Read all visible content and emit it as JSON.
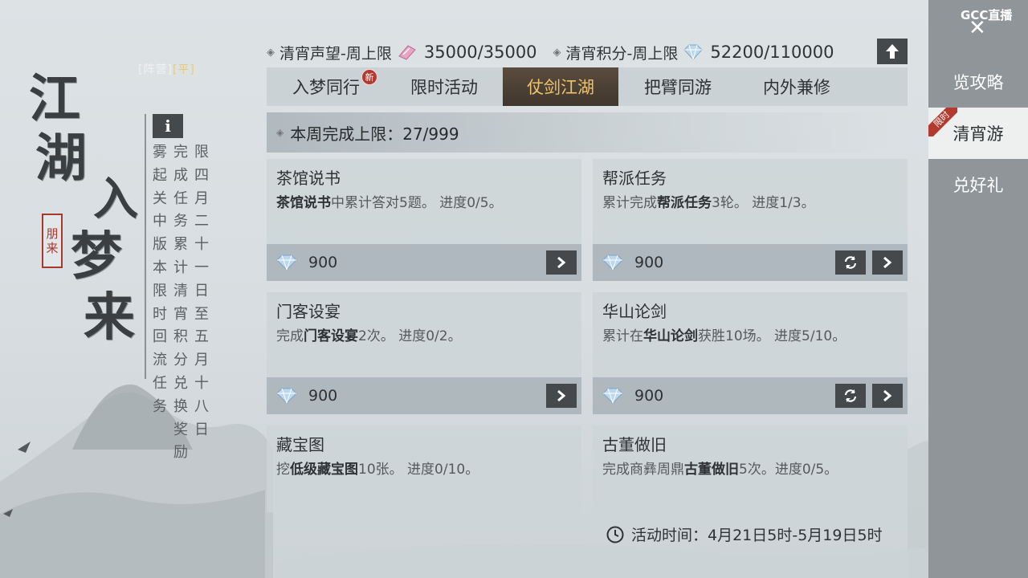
{
  "header": {
    "faint_tags": [
      "[阵营]",
      "[平]"
    ],
    "stat1": {
      "label": "清宵声望-周上限",
      "value": "35000/35000"
    },
    "stat2": {
      "label": "清宵积分-周上限",
      "value": "52200/110000"
    },
    "up_icon": "arrow-up-icon"
  },
  "title_art": {
    "chars": [
      "江",
      "湖",
      "入",
      "梦",
      "来"
    ],
    "seal": [
      "朋",
      "来"
    ]
  },
  "info": {
    "button": "i",
    "columns": [
      "雾起关中版本限时回流任务",
      "完成任务累计清宵积分兑换奖励",
      "限四月二十一日至五月十八日"
    ]
  },
  "tabs": [
    {
      "label": "入梦同行",
      "badge": "新"
    },
    {
      "label": "限时活动"
    },
    {
      "label": "仗剑江湖"
    },
    {
      "label": "把臂同游"
    },
    {
      "label": "内外兼修"
    }
  ],
  "banner": {
    "text": "本周完成上限：27/999"
  },
  "tasks": [
    {
      "name": "茶馆说书",
      "desc_pre": "",
      "desc_bold": "茶馆说书",
      "desc_post": "中累计答对5题。 进度0/5。",
      "reward": "900"
    },
    {
      "name": "帮派任务",
      "desc_pre": "累计完成",
      "desc_bold": "帮派任务",
      "desc_post": "3轮。 进度1/3。",
      "reward": "900"
    },
    {
      "name": "门客设宴",
      "desc_pre": "完成",
      "desc_bold": "门客设宴",
      "desc_post": "2次。 进度0/2。",
      "reward": "900"
    },
    {
      "name": "华山论剑",
      "desc_pre": "累计在",
      "desc_bold": "华山论剑",
      "desc_post": "获胜10场。 进度5/10。",
      "reward": "900"
    },
    {
      "name": "藏宝图",
      "desc_pre": "挖",
      "desc_bold": "低级藏宝图",
      "desc_post": "10张。 进度0/10。"
    },
    {
      "name": "古董做旧",
      "desc_pre": "完成商彝周鼎",
      "desc_bold": "古董做旧",
      "desc_post": "5次。进度0/5。"
    }
  ],
  "activity_time": "活动时间：4月21日5时-5月19日5时",
  "sidebar": {
    "logo": "CC直播",
    "items": [
      "览攻略",
      "清宵游",
      "兑好礼"
    ],
    "limit_tag": "限时"
  },
  "colors": {
    "accent_gold": "#f0c36a",
    "badge_red": "#b23a2e",
    "button_dark": "#45494c"
  }
}
